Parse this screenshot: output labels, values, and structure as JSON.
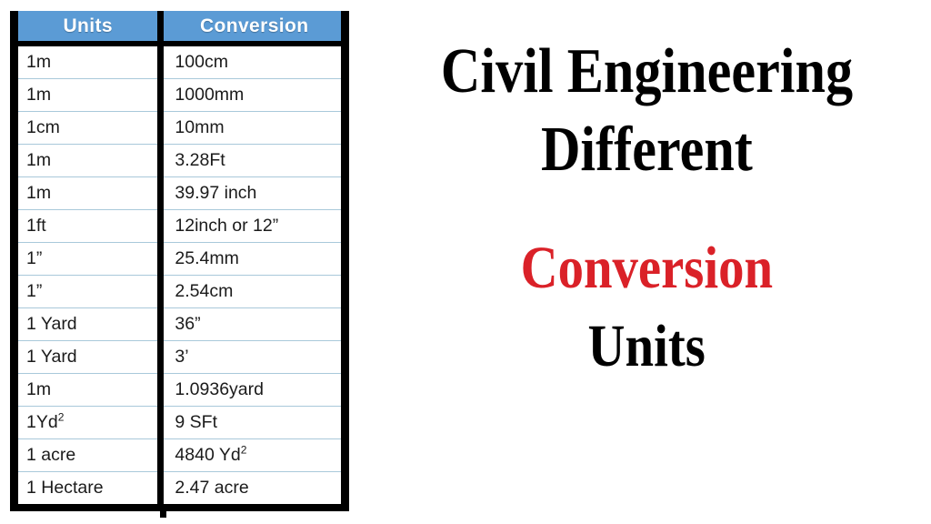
{
  "table": {
    "columns": [
      "Units",
      "Conversion"
    ],
    "header_bg": "#5b9bd5",
    "header_text_color": "#ffffff",
    "border_color": "#000000",
    "row_separator_color": "#a9c9da",
    "rows": [
      {
        "units": "1m",
        "conversion": "100cm"
      },
      {
        "units": "1m",
        "conversion": "1000mm"
      },
      {
        "units": "1cm",
        "conversion": "10mm"
      },
      {
        "units": "1m",
        "conversion": "3.28Ft"
      },
      {
        "units": "1m",
        "conversion": "39.97 inch"
      },
      {
        "units": "1ft",
        "conversion": "12inch or 12”"
      },
      {
        "units": "1”",
        "conversion": "25.4mm"
      },
      {
        "units": "1”",
        "conversion": "2.54cm"
      },
      {
        "units": "1 Yard",
        "conversion": "36”"
      },
      {
        "units": "1 Yard",
        "conversion": "3’"
      },
      {
        "units": "1m",
        "conversion": "1.0936yard"
      },
      {
        "units": "1Yd²",
        "conversion": "9 SFt"
      },
      {
        "units": "1 acre",
        "conversion": "4840 Yd²"
      },
      {
        "units": "1 Hectare",
        "conversion": "2.47 acre"
      }
    ]
  },
  "headline": {
    "line1": "Civil Engineering",
    "line2": "Different",
    "line3": "Conversion",
    "line4": "Units",
    "line3_color": "#da2128",
    "default_color": "#000000"
  }
}
